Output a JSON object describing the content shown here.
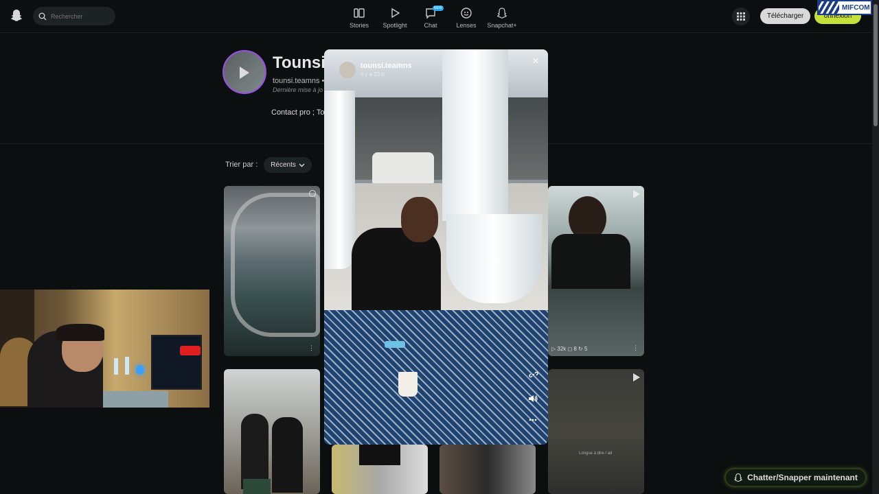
{
  "topbar": {
    "search_placeholder": "Rechercher",
    "nav": [
      {
        "label": "Stories",
        "icon": "stories-icon"
      },
      {
        "label": "Spotlight",
        "icon": "play-icon"
      },
      {
        "label": "Chat",
        "icon": "chat-icon",
        "badge": "NEW"
      },
      {
        "label": "Lenses",
        "icon": "lens-icon"
      },
      {
        "label": "Snapchat+",
        "icon": "ghost-plus-icon"
      }
    ],
    "download_label": "Télécharger",
    "login_label": "onnexion",
    "overlay_brand": "MIFCOM"
  },
  "profile": {
    "name": "Tounsi",
    "handle": "tounsi.teamns •",
    "updated": "Dernière mise à jo",
    "contact": "Contact pro ; To"
  },
  "sort": {
    "label": "Trier par :",
    "value": "Récents"
  },
  "tiles": {
    "tile3_stats": "▷ 32k  ◻ 8  ↻ 5",
    "tile_more": "⋮",
    "tile6_caption": "Longue à dire / ad"
  },
  "modal": {
    "username": "tounsi.teamns",
    "time": "Il y a 23 h",
    "close_icon": "×"
  },
  "chat_button": {
    "label": "Chatter/Snapper maintenant"
  },
  "colors": {
    "background": "#0b0f0f",
    "accent_yellow": "#c6e03a",
    "avatar_ring": "#9a4ee8"
  }
}
